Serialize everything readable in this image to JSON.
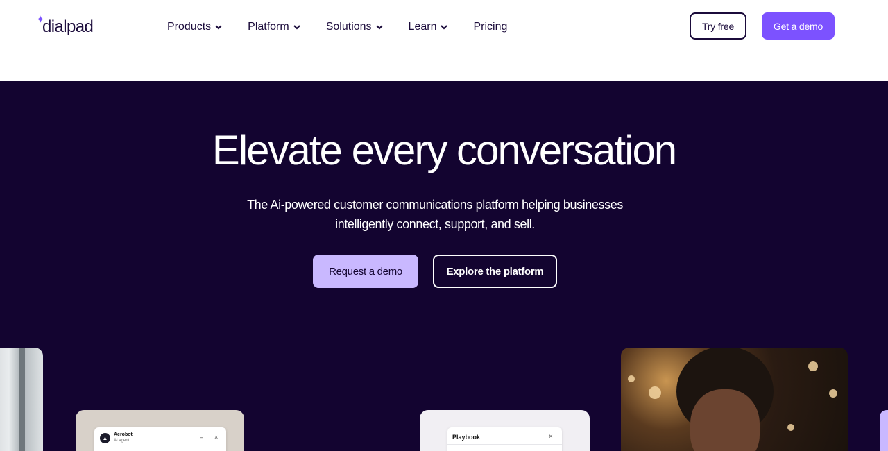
{
  "header": {
    "logo": "dialpad",
    "nav": [
      {
        "label": "Products",
        "has_dropdown": true
      },
      {
        "label": "Platform",
        "has_dropdown": true
      },
      {
        "label": "Solutions",
        "has_dropdown": true
      },
      {
        "label": "Learn",
        "has_dropdown": true
      },
      {
        "label": "Pricing",
        "has_dropdown": false
      }
    ],
    "try_free": "Try free",
    "get_demo": "Get a demo"
  },
  "hero": {
    "title": "Elevate every conversation",
    "subtitle_line1": "The Ai-powered customer communications platform helping businesses",
    "subtitle_line2": "intelligently connect, support, and sell.",
    "request_demo": "Request a demo",
    "explore": "Explore the platform"
  },
  "cards": {
    "aerobot": {
      "name": "Aerobot",
      "role": "AI agent",
      "minimize": "–",
      "close": "×"
    },
    "playbook": {
      "title": "Playbook",
      "close": "×"
    }
  },
  "colors": {
    "brand_purple": "#7c52ff",
    "hero_bg": "#130430",
    "light_purple": "#c9b8ff",
    "dark_text": "#1b0b3b"
  }
}
